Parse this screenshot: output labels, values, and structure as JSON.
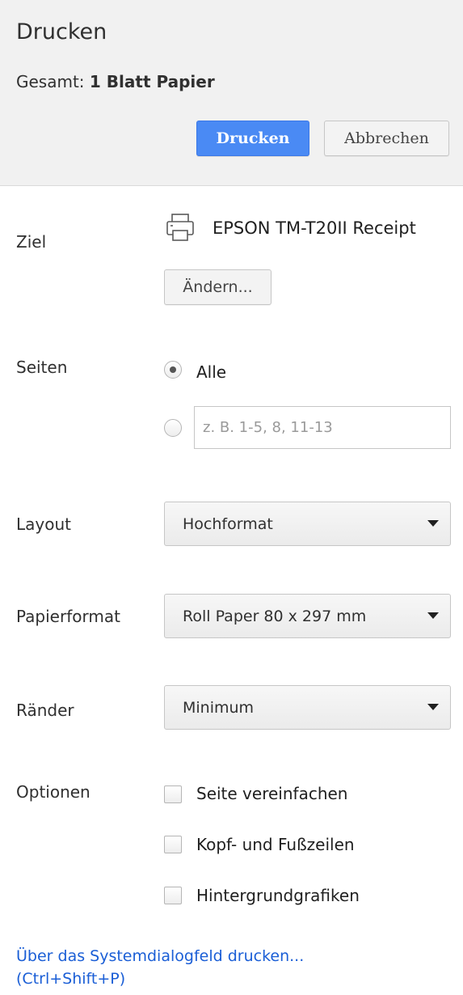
{
  "header": {
    "title": "Drucken",
    "summary_prefix": "Gesamt: ",
    "summary_value": "1 Blatt Papier",
    "print_button": "Drucken",
    "cancel_button": "Abbrechen"
  },
  "destination": {
    "label": "Ziel",
    "printer_icon": "printer-icon",
    "printer_name": "EPSON TM-T20II Receipt",
    "change_button": "Ändern..."
  },
  "pages": {
    "label": "Seiten",
    "selected": "all",
    "all_label": "Alle",
    "custom_placeholder": "z. B. 1-5, 8, 11-13",
    "custom_value": ""
  },
  "layout": {
    "label": "Layout",
    "value": "Hochformat"
  },
  "paper_format": {
    "label": "Papierformat",
    "value": "Roll Paper 80 x 297 mm"
  },
  "margins": {
    "label": "Ränder",
    "value": "Minimum"
  },
  "options": {
    "label": "Optionen",
    "items": [
      {
        "label": "Seite vereinfachen",
        "checked": false
      },
      {
        "label": "Kopf- und Fußzeilen",
        "checked": false
      },
      {
        "label": "Hintergrundgrafiken",
        "checked": false
      }
    ]
  },
  "system_dialog": {
    "line1": "Über das Systemdialogfeld drucken...",
    "line2": "(Ctrl+Shift+P)"
  },
  "colors": {
    "primary_button": "#4a8af4",
    "link": "#1a5ed6",
    "header_bg": "#f1f1f1"
  }
}
